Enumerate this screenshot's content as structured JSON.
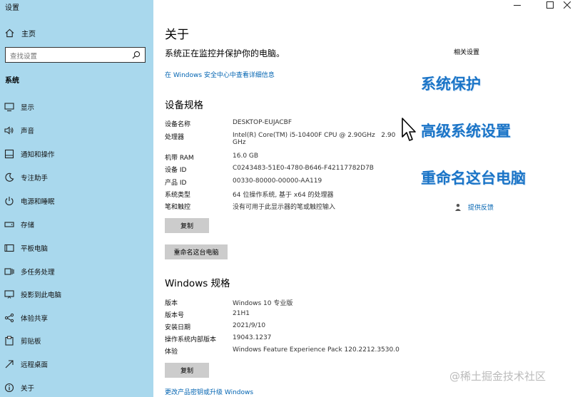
{
  "app": {
    "title": "设置"
  },
  "sidebar": {
    "home": "主页",
    "search_placeholder": "查找设置",
    "section": "系统",
    "items": [
      {
        "label": "显示"
      },
      {
        "label": "声音"
      },
      {
        "label": "通知和操作"
      },
      {
        "label": "专注助手"
      },
      {
        "label": "电源和睡眠"
      },
      {
        "label": "存储"
      },
      {
        "label": "平板电脑"
      },
      {
        "label": "多任务处理"
      },
      {
        "label": "投影到此电脑"
      },
      {
        "label": "体验共享"
      },
      {
        "label": "剪贴板"
      },
      {
        "label": "远程桌面"
      },
      {
        "label": "关于"
      }
    ]
  },
  "main": {
    "title": "关于",
    "protect_text": "系统正在监控并保护你的电脑。",
    "security_link": "在 Windows 安全中心中查看详细信息",
    "device_spec_title": "设备规格",
    "device_specs": [
      {
        "label": "设备名称",
        "value": "DESKTOP-EUJACBF"
      },
      {
        "label": "处理器",
        "value": "Intel(R) Core(TM) i5-10400F CPU @ 2.90GHz   2.90",
        "value2": "GHz"
      },
      {
        "label": "机带 RAM",
        "value": "16.0 GB"
      },
      {
        "label": "设备 ID",
        "value": "C0243483-51E0-4780-B646-F42117782D7B"
      },
      {
        "label": "产品 ID",
        "value": "00330-80000-00000-AA119"
      },
      {
        "label": "系统类型",
        "value": "64 位操作系统, 基于 x64 的处理器"
      },
      {
        "label": "笔和触控",
        "value": "没有可用于此显示器的笔或触控输入"
      }
    ],
    "copy_button": "复制",
    "rename_button": "重命名这台电脑",
    "windows_spec_title": "Windows 规格",
    "windows_specs": [
      {
        "label": "版本",
        "value": "Windows 10 专业版"
      },
      {
        "label": "版本号",
        "value": "21H1"
      },
      {
        "label": "安装日期",
        "value": "2021/9/10"
      },
      {
        "label": "操作系统内部版本",
        "value": "19043.1237"
      },
      {
        "label": "体验",
        "value": "Windows Feature Experience Pack 120.2212.3530.0"
      }
    ],
    "copy_button2": "复制",
    "product_key_link": "更改产品密钥或升级 Windows"
  },
  "related": {
    "title": "相关设置",
    "system_protection": "系统保护",
    "advanced_settings": "高级系统设置",
    "rename_pc": "重命名这台电脑",
    "feedback": "提供反馈"
  },
  "watermark": "@稀土掘金技术社区",
  "colors": {
    "sidebar_bg": "#a9d8ed",
    "accent": "#0063b1",
    "big_link": "#1a74c7"
  }
}
